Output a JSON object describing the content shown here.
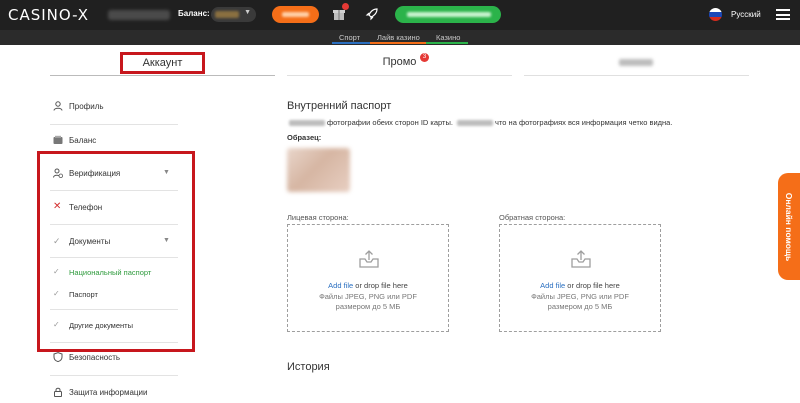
{
  "header": {
    "logo": "CASINO-X",
    "balance_label": "Баланс:",
    "language": "Русский",
    "colors": {
      "deposit": "#f56e18",
      "green": "#2bb34a",
      "background": "#202020"
    }
  },
  "subnav": {
    "items": [
      {
        "label": "Спорт",
        "color": "#2a6fc0"
      },
      {
        "label": "Лайв казино",
        "color": "#f56e18"
      },
      {
        "label": "Казино",
        "color": "#2bb34a"
      }
    ]
  },
  "tabs": {
    "account": "Аккаунт",
    "promo": "Промо",
    "promo_badge": "3"
  },
  "sidebar": {
    "items": [
      {
        "label": "Профиль",
        "icon": "user-icon"
      },
      {
        "label": "Баланс",
        "icon": "wallet-icon"
      },
      {
        "label": "Верификация",
        "icon": "user-check-icon"
      },
      {
        "label": "Телефон",
        "icon": "cross-icon"
      },
      {
        "label": "Документы",
        "icon": "check-icon"
      },
      {
        "label": "Безопасность",
        "icon": "shield-icon"
      },
      {
        "label": "Защита информации",
        "icon": "lock-icon"
      }
    ],
    "documents": [
      {
        "label": "Национальный паспорт",
        "active": true,
        "color": "#2e9a3c"
      },
      {
        "label": "Паспорт",
        "active": false
      },
      {
        "label": "Другие документы",
        "active": false
      }
    ]
  },
  "main": {
    "title": "Внутренний паспорт",
    "desc_part1": "фотографии обеих сторон ID карты.",
    "desc_part2": "что на фотографиях вся информация четко видна.",
    "sample_label": "Образец:",
    "front_label": "Лицевая сторона:",
    "back_label": "Обратная сторона:",
    "upload": {
      "link": "Add file",
      "text": " or drop file here",
      "formats": "Файлы JPEG, PNG или PDF",
      "size": "размером до 5 МБ"
    },
    "history": "История"
  },
  "help": {
    "label": "Онлайн помощь"
  }
}
